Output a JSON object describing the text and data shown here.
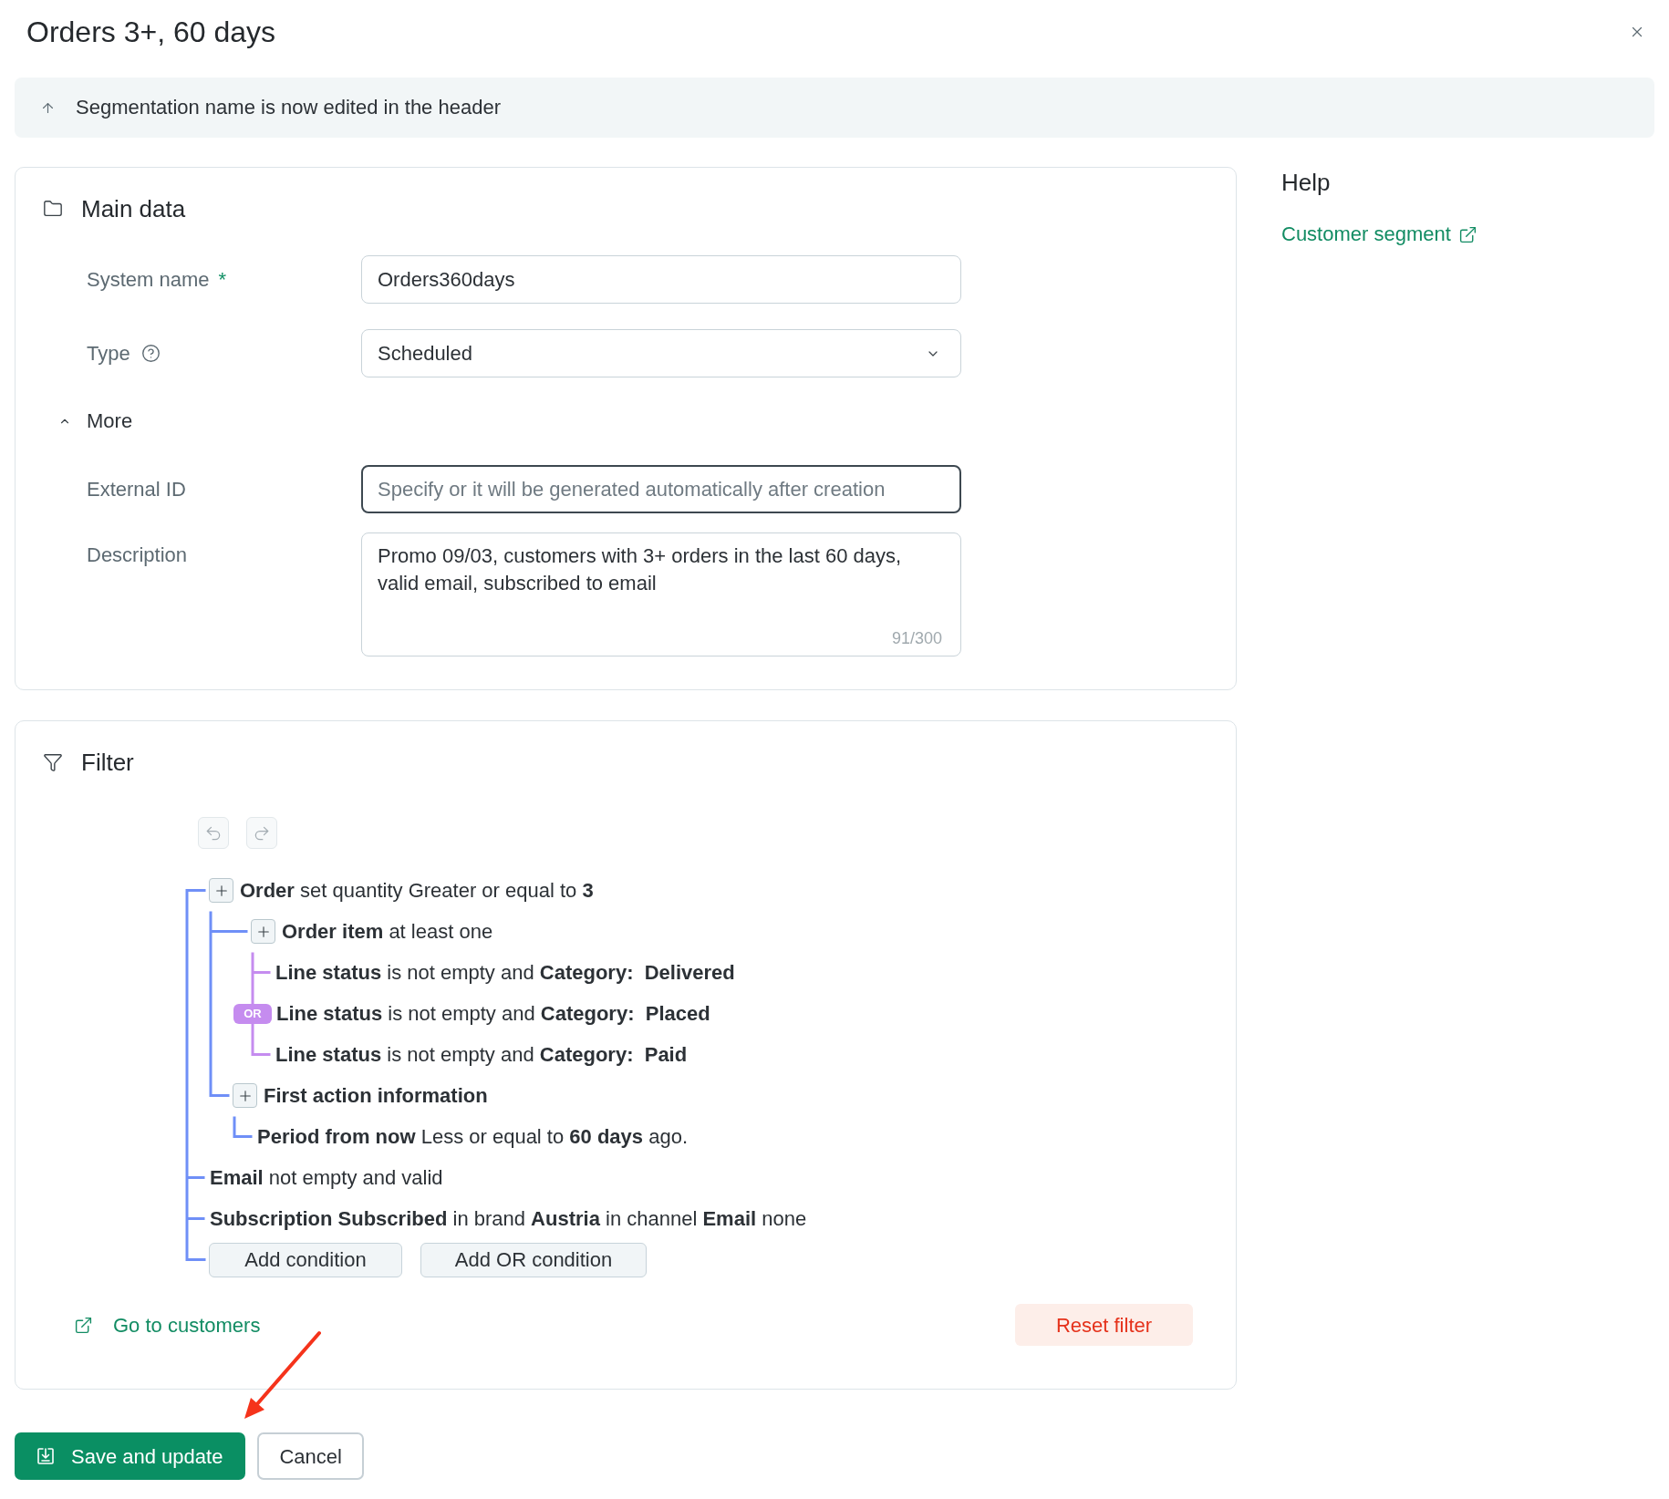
{
  "dialog": {
    "title": "Orders 3+, 60 days"
  },
  "notice": {
    "text": "Segmentation name is now edited in the header"
  },
  "main_data": {
    "title": "Main data",
    "fields": [
      {
        "kind": "text",
        "label": "System name",
        "required_mark": "*",
        "value": "Orders360days"
      },
      {
        "kind": "select",
        "label": "Type",
        "help": true,
        "value": "Scheduled"
      }
    ],
    "more": {
      "label": "More",
      "expanded": true
    },
    "more_fields": [
      {
        "kind": "text",
        "label": "External ID",
        "placeholder": "Specify or it will be generated automatically after creation",
        "focused": true
      },
      {
        "kind": "textarea",
        "label": "Description",
        "value": "Promo 09/03, customers with 3+ orders in the last 60 days, valid email, subscribed to email",
        "counter": "91/300"
      }
    ]
  },
  "filter": {
    "title": "Filter",
    "history": [
      {
        "kind": "undo",
        "disabled": true
      },
      {
        "kind": "redo",
        "disabled": true
      }
    ],
    "conditions": [
      {
        "text": "**Order** set quantity Greater or equal to **3**",
        "children": [
          {
            "text": "**Order item** at least one",
            "operator": "OR",
            "children": [
              {
                "text": "**Line status** is not empty and **Category:  Delivered**"
              },
              {
                "text": "**Line status** is not empty and **Category:  Placed**"
              },
              {
                "text": "**Line status** is not empty and **Category:  Paid**"
              }
            ]
          },
          {
            "text": "First action information",
            "bold": true,
            "children": [
              {
                "text": "**Period from now** Less or equal to **60 days** ago."
              }
            ]
          }
        ]
      },
      {
        "text": "**Email** not empty and valid"
      },
      {
        "text": "**Subscription Subscribed** in brand **Austria** in channel **Email** none"
      }
    ],
    "add_buttons": [
      "Add condition",
      "Add OR condition"
    ],
    "link": "Go to customers",
    "reset": "Reset filter"
  },
  "help": {
    "title": "Help",
    "link": "Customer segment"
  },
  "actions": [
    {
      "kind": "primary",
      "label": "Save and update"
    },
    {
      "kind": "secondary",
      "label": "Cancel"
    }
  ]
}
